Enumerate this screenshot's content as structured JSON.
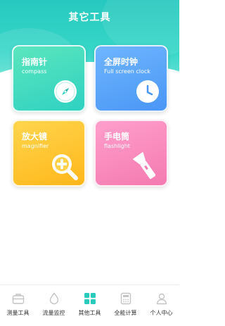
{
  "header": {
    "title": "其它工具"
  },
  "tools": [
    {
      "title": "指南针",
      "subtitle": "compass",
      "icon": "compass-icon"
    },
    {
      "title": "全屏时钟",
      "subtitle": "Full screen clock",
      "icon": "clock-icon"
    },
    {
      "title": "放大镜",
      "subtitle": "magnifier",
      "icon": "magnifier-icon"
    },
    {
      "title": "手电筒",
      "subtitle": "flashlight",
      "icon": "flashlight-icon"
    }
  ],
  "tabbar": {
    "items": [
      {
        "label": "测量工具",
        "icon": "toolbox-icon"
      },
      {
        "label": "流量监控",
        "icon": "droplet-icon"
      },
      {
        "label": "其他工具",
        "icon": "grid-icon",
        "active": true
      },
      {
        "label": "全能计算",
        "icon": "calculator-icon"
      },
      {
        "label": "个人中心",
        "icon": "person-icon"
      }
    ]
  },
  "colors": {
    "accent": "#2cc9bd",
    "compass_card": "#2fd1c2",
    "clock_card": "#4a96f5",
    "magnifier_card": "#ffb71a",
    "flashlight_card": "#f47ab0",
    "tab_inactive": "#c4c4c4"
  }
}
